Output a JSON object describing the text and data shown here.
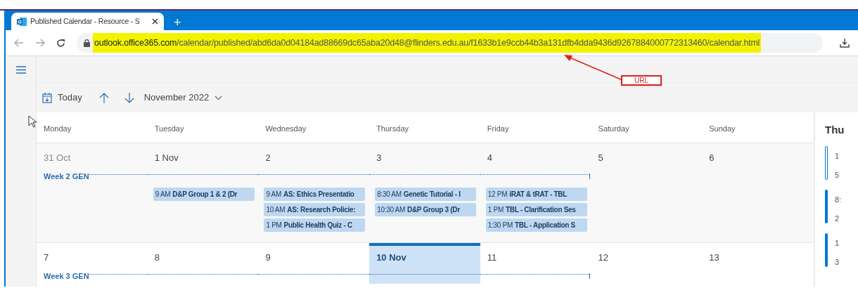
{
  "browser": {
    "tab": {
      "title": "Published Calendar - Resource - S"
    },
    "new_tab": "+",
    "url": {
      "host": "outlook.office365.com",
      "path": "/calendar/published/abd6da0d04184ad88669dc65aba20d48@flinders.edu.au/f1633b1e9ccb44b3a131dfb4dda9436d9267884000772313460/calendar.html"
    }
  },
  "annotation": {
    "label": "URL"
  },
  "toolbar": {
    "today": "Today",
    "month": "November 2022"
  },
  "weekdays": [
    "Monday",
    "Tuesday",
    "Wednesday",
    "Thursday",
    "Friday",
    "Saturday",
    "Sunday"
  ],
  "weeks": [
    {
      "banner": "Week 2 GEN",
      "days": [
        {
          "date": "31 Oct",
          "outside_month": true,
          "today": false,
          "in_banner": true
        },
        {
          "date": "1 Nov",
          "outside_month": false,
          "today": false,
          "in_banner": true,
          "events": [
            {
              "time": "9 AM",
              "title": "D&P Group 1 & 2 (Dr"
            }
          ]
        },
        {
          "date": "2",
          "outside_month": false,
          "today": false,
          "in_banner": true,
          "events": [
            {
              "time": "9 AM",
              "title": "AS: Ethics Presentatio"
            },
            {
              "time": "10 AM",
              "title": "AS: Research Policie:"
            },
            {
              "time": "1 PM",
              "title": "Public Health Quiz - C"
            }
          ]
        },
        {
          "date": "3",
          "outside_month": false,
          "today": false,
          "in_banner": true,
          "events": [
            {
              "time": "8:30 AM",
              "title": "Genetic Tutorial - I"
            },
            {
              "time": "10:30 AM",
              "title": "D&P Group 3 (Dr"
            }
          ]
        },
        {
          "date": "4",
          "outside_month": false,
          "today": false,
          "in_banner": true,
          "events": [
            {
              "time": "12 PM",
              "title": "iRAT & tRAT - TBL"
            },
            {
              "time": "1 PM",
              "title": "TBL - Clarification Ses"
            },
            {
              "time": "1:30 PM",
              "title": "TBL - Application S"
            }
          ]
        },
        {
          "date": "5",
          "outside_month": false,
          "today": false,
          "in_banner": false
        },
        {
          "date": "6",
          "outside_month": false,
          "today": false,
          "in_banner": false
        }
      ]
    },
    {
      "banner": "Week 3 GEN",
      "days": [
        {
          "date": "7",
          "outside_month": false,
          "today": false,
          "in_banner": true
        },
        {
          "date": "8",
          "outside_month": false,
          "today": false,
          "in_banner": true
        },
        {
          "date": "9",
          "outside_month": false,
          "today": false,
          "in_banner": true
        },
        {
          "date": "10 Nov",
          "outside_month": false,
          "today": true,
          "in_banner": true
        },
        {
          "date": "11",
          "outside_month": false,
          "today": false,
          "in_banner": true
        },
        {
          "date": "12",
          "outside_month": false,
          "today": false,
          "in_banner": false
        },
        {
          "date": "13",
          "outside_month": false,
          "today": false,
          "in_banner": false
        }
      ]
    }
  ],
  "agenda": {
    "heading": "Thu",
    "items": [
      {
        "kind": "outline",
        "time": "1",
        "line_2": "5"
      },
      {
        "kind": "solid",
        "time": "8:",
        "line_2": "2"
      },
      {
        "kind": "solid",
        "time": "1",
        "line_2": "3"
      }
    ]
  }
}
